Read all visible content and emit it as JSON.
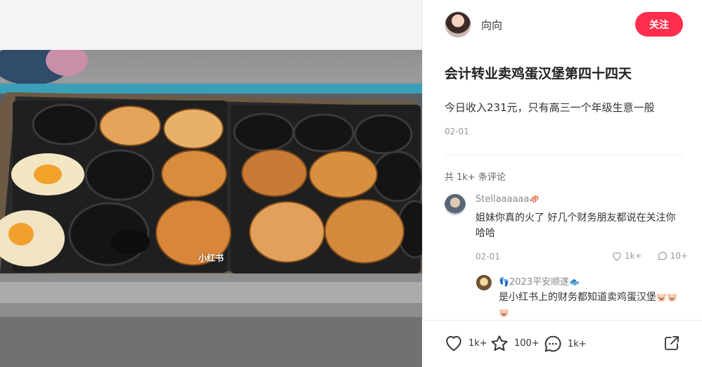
{
  "post": {
    "watermark": "小红书",
    "author": {
      "name": "向向"
    },
    "follow_label": "关注",
    "title": "会计转业卖鸡蛋汉堡第四十四天",
    "description": "今日收入231元，只有高三一个年级生意一般",
    "date": "02-01",
    "comment_count_label": "共 1k+ 条评论"
  },
  "comments": [
    {
      "user": "Stellaaaaaa",
      "user_emoji": "🛷",
      "text": "姐妹你真的火了 好几个财务朋友都说在关注你哈哈",
      "date": "02-01",
      "likes": "1k+",
      "replies": "10+"
    },
    {
      "user_prefix": "👣",
      "user": "2023平安顺遂",
      "user_emoji": "🐟",
      "text": "是小红书上的财务都知道卖鸡蛋汉堡",
      "text_emoji": "🐷🐷🐷"
    }
  ],
  "actions": {
    "likes": "1k+",
    "collects": "100+",
    "comments": "1k+"
  },
  "colors": {
    "accent": "#ff2e4d",
    "muted": "#999999"
  }
}
